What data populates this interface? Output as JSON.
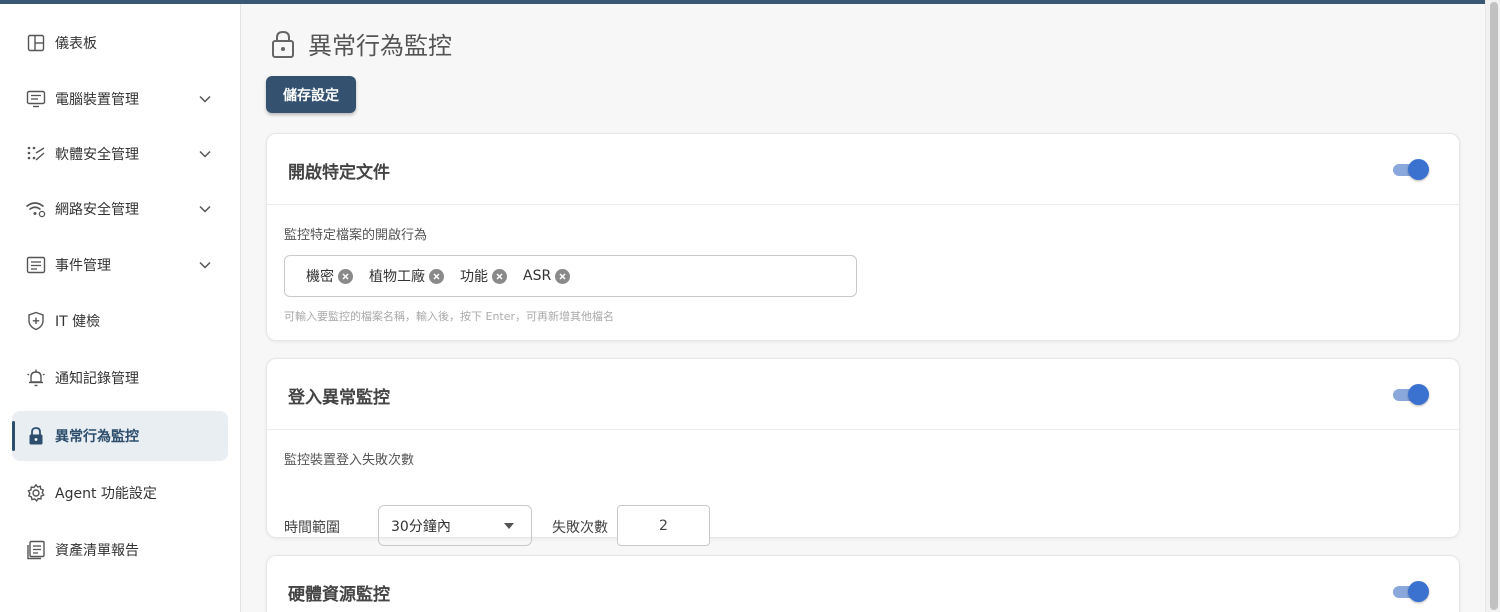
{
  "sidebar": {
    "items": [
      {
        "label": "儀表板",
        "icon": "dashboard-icon"
      },
      {
        "label": "電腦裝置管理",
        "icon": "monitor-icon"
      },
      {
        "label": "軟體安全管理",
        "icon": "software-icon"
      },
      {
        "label": "網路安全管理",
        "icon": "wifi-gear-icon"
      },
      {
        "label": "事件管理",
        "icon": "event-list-icon"
      },
      {
        "label": "IT 健檢",
        "icon": "shield-plus-icon"
      },
      {
        "label": "通知記錄管理",
        "icon": "bell-icon"
      },
      {
        "label": "異常行為監控",
        "icon": "lock-icon"
      },
      {
        "label": "Agent 功能設定",
        "icon": "gear-icon"
      },
      {
        "label": "資產清單報告",
        "icon": "report-icon"
      }
    ]
  },
  "header": {
    "title": "異常行為監控",
    "save_label": "儲存設定"
  },
  "cards": {
    "open_file": {
      "title": "開啟特定文件",
      "enabled": true,
      "sub_label": "監控特定檔案的開啟行為",
      "tags": [
        "機密",
        "植物工廠",
        "功能",
        "ASR"
      ],
      "hint": "可輸入要監控的檔案名稱，輸入後，按下 Enter，可再新增其他檔名"
    },
    "login": {
      "title": "登入異常監控",
      "enabled": true,
      "sub_label": "監控裝置登入失敗次數",
      "range_label": "時間範圍",
      "range_value": "30分鐘內",
      "fail_label": "失敗次數",
      "fail_value": "2"
    },
    "hardware": {
      "title": "硬體資源監控",
      "enabled": true
    }
  },
  "colors": {
    "accent": "#345270",
    "toggle_on": "#3b72cf",
    "active_bg": "#e9eef3"
  }
}
